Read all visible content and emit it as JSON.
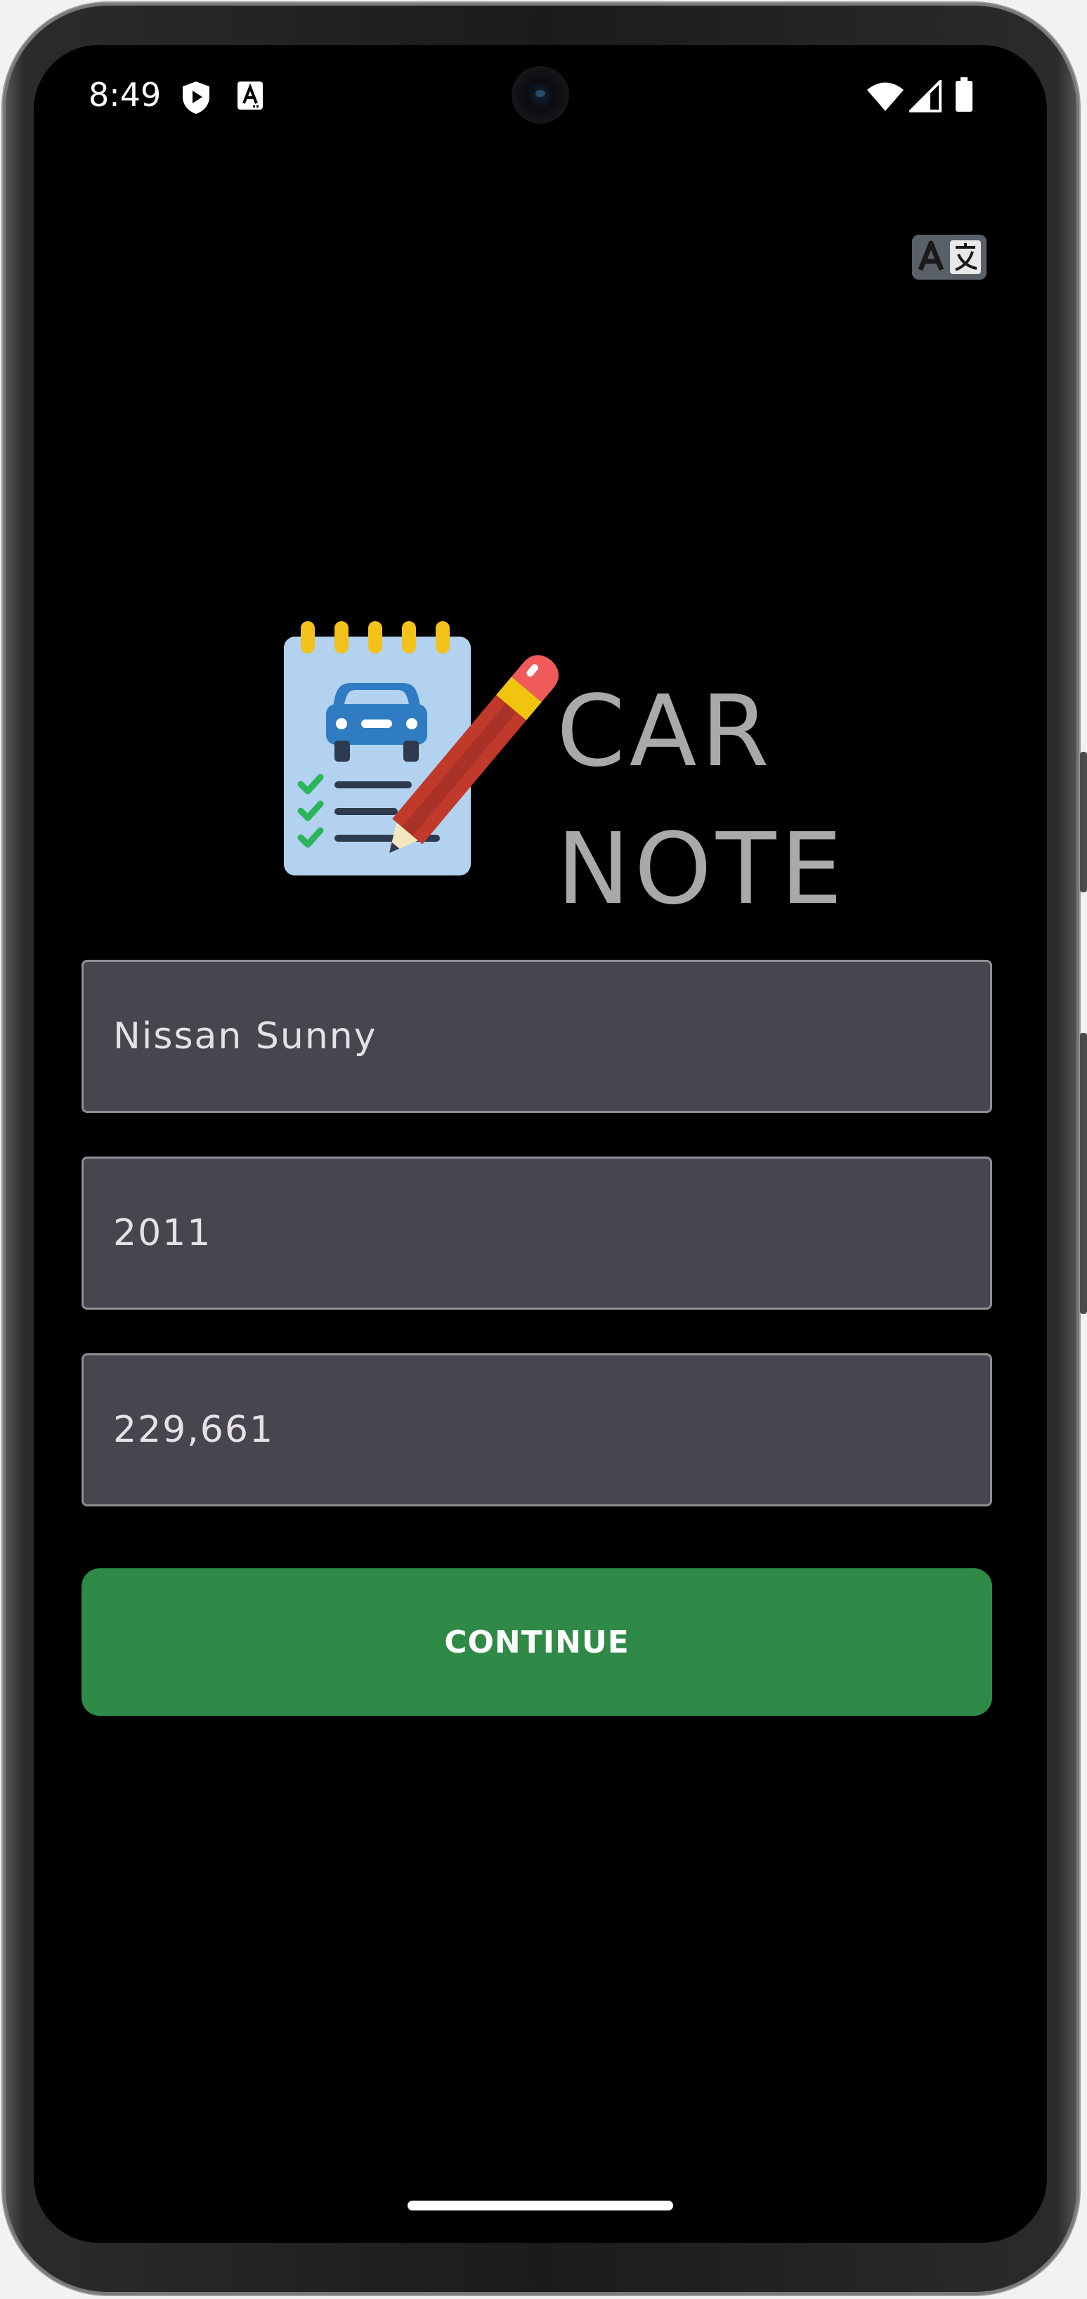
{
  "status_bar": {
    "time": "8:49",
    "icons": [
      "shield-play-icon",
      "text-a-icon",
      "wifi-icon",
      "signal-icon",
      "battery-icon"
    ]
  },
  "toolbar": {
    "translate_icon": "translate-icon"
  },
  "logo": {
    "line1": "CAR",
    "line2": "NOTE",
    "icon": "car-notepad-pencil-icon"
  },
  "form": {
    "car_model_value": "Nissan Sunny",
    "year_value": "2011",
    "mileage_value": "229,661",
    "continue_label": "CONTINUE"
  },
  "colors": {
    "background": "#000000",
    "field_bg": "#49454f",
    "field_border": "#8e8e93",
    "field_text": "#e6e1e5",
    "button_green": "#2e8a46",
    "logo_text": "#a9a9a9"
  }
}
